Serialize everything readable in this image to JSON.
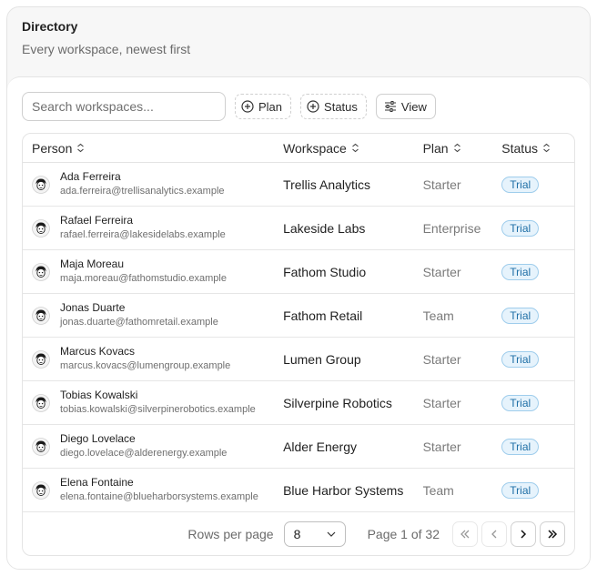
{
  "header": {
    "title": "Directory",
    "subtitle": "Every workspace, newest first"
  },
  "toolbar": {
    "search_placeholder": "Search workspaces...",
    "plan_filter": "Plan",
    "status_filter": "Status",
    "view_button": "View"
  },
  "table": {
    "columns": [
      "Person",
      "Workspace",
      "Plan",
      "Status"
    ],
    "rows": [
      {
        "name": "Ada Ferreira",
        "email": "ada.ferreira@trellisanalytics.example",
        "workspace": "Trellis Analytics",
        "plan": "Starter",
        "status": "Trial"
      },
      {
        "name": "Rafael Ferreira",
        "email": "rafael.ferreira@lakesidelabs.example",
        "workspace": "Lakeside Labs",
        "plan": "Enterprise",
        "status": "Trial"
      },
      {
        "name": "Maja Moreau",
        "email": "maja.moreau@fathomstudio.example",
        "workspace": "Fathom Studio",
        "plan": "Starter",
        "status": "Trial"
      },
      {
        "name": "Jonas Duarte",
        "email": "jonas.duarte@fathomretail.example",
        "workspace": "Fathom Retail",
        "plan": "Team",
        "status": "Trial"
      },
      {
        "name": "Marcus Kovacs",
        "email": "marcus.kovacs@lumengroup.example",
        "workspace": "Lumen Group",
        "plan": "Starter",
        "status": "Trial"
      },
      {
        "name": "Tobias Kowalski",
        "email": "tobias.kowalski@silverpinerobotics.example",
        "workspace": "Silverpine Robotics",
        "plan": "Starter",
        "status": "Trial"
      },
      {
        "name": "Diego Lovelace",
        "email": "diego.lovelace@alderenergy.example",
        "workspace": "Alder Energy",
        "plan": "Starter",
        "status": "Trial"
      },
      {
        "name": "Elena Fontaine",
        "email": "elena.fontaine@blueharborsystems.example",
        "workspace": "Blue Harbor Systems",
        "plan": "Team",
        "status": "Trial"
      }
    ]
  },
  "pagination": {
    "rows_per_page_label": "Rows per page",
    "rows_per_page_value": "8",
    "page_info": "Page 1 of 32"
  },
  "colors": {
    "badge_bg": "#e6f3fc",
    "badge_border": "#9fcdec",
    "badge_text": "#1f6fa6"
  },
  "icons": {
    "sort": "chevron-up-down-icon",
    "filter": "plus-circle-icon",
    "view": "sliders-icon",
    "avatar": "cartoon-avatar-icon"
  }
}
